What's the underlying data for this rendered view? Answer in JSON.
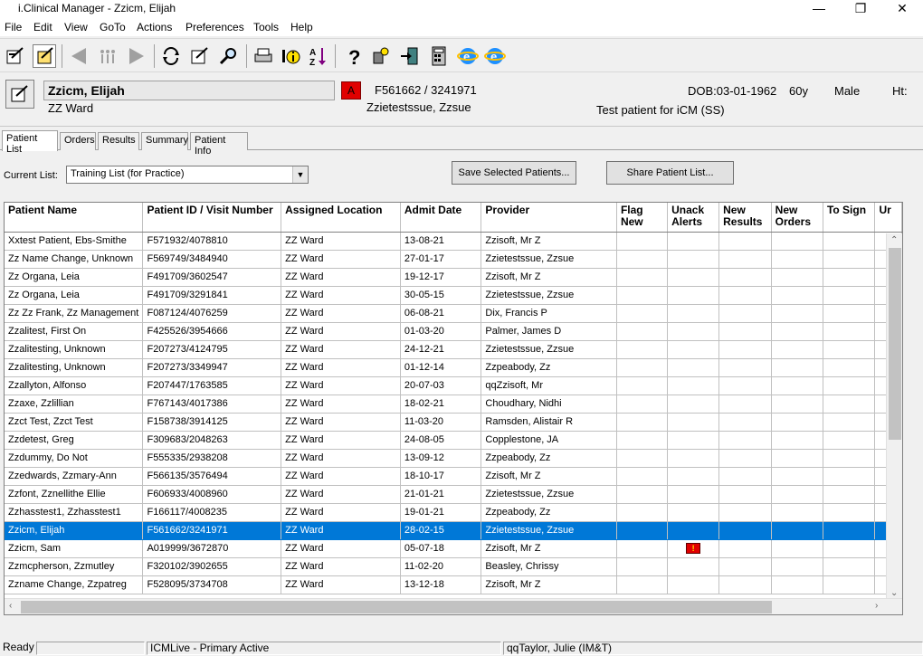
{
  "window": {
    "title": "i.Clinical Manager - Zzicm, Elijah"
  },
  "menu": [
    "File",
    "Edit",
    "View",
    "GoTo",
    "Actions",
    "Preferences",
    "Tools",
    "Help"
  ],
  "patient": {
    "name": "Zzicm, Elijah",
    "ward": "ZZ Ward",
    "alert": "A",
    "id_visit": "F561662 / 3241971",
    "provider": "Zzietestssue, Zzsue",
    "dob": "DOB:03-01-1962",
    "age": "60y",
    "sex": "Male",
    "ht": "Ht:",
    "note": "Test patient for iCM (SS)"
  },
  "tabs": [
    "Patient List",
    "Orders",
    "Results",
    "Summary",
    "Patient Info"
  ],
  "controls": {
    "current_list_label": "Current List:",
    "current_list_value": "Training List (for Practice)",
    "save_button": "Save Selected Patients...",
    "share_button": "Share Patient List..."
  },
  "table": {
    "headers": [
      "Patient Name",
      "Patient ID / Visit Number",
      "Assigned Location",
      "Admit Date",
      "Provider",
      "Flag New",
      "Unack Alerts",
      "New Results",
      "New Orders",
      "To Sign",
      "Ur"
    ],
    "header_lines": [
      [
        "Patient Name"
      ],
      [
        "Patient ID / Visit Number"
      ],
      [
        "Assigned Location"
      ],
      [
        "Admit Date"
      ],
      [
        "Provider"
      ],
      [
        "Flag",
        "New"
      ],
      [
        "Unack",
        "Alerts"
      ],
      [
        "New",
        "Results"
      ],
      [
        "New",
        "Orders"
      ],
      [
        "To Sign"
      ],
      [
        "Ur"
      ]
    ],
    "rows": [
      [
        "Xxtest Patient, Ebs-Smithe",
        "F571932/4078810",
        "ZZ Ward",
        "13-08-21",
        "Zzisoft, Mr Z"
      ],
      [
        "Zz Name Change, Unknown",
        "F569749/3484940",
        "ZZ Ward",
        "27-01-17",
        "Zzietestssue, Zzsue"
      ],
      [
        "Zz Organa, Leia",
        "F491709/3602547",
        "ZZ Ward",
        "19-12-17",
        "Zzisoft, Mr Z"
      ],
      [
        "Zz Organa, Leia",
        "F491709/3291841",
        "ZZ Ward",
        "30-05-15",
        "Zzietestssue, Zzsue"
      ],
      [
        "Zz Zz Frank, Zz Management",
        "F087124/4076259",
        "ZZ Ward",
        "06-08-21",
        "Dix, Francis P"
      ],
      [
        "Zzalitest, First On",
        "F425526/3954666",
        "ZZ Ward",
        "01-03-20",
        "Palmer, James D"
      ],
      [
        "Zzalitesting, Unknown",
        "F207273/4124795",
        "ZZ Ward",
        "24-12-21",
        "Zzietestssue, Zzsue"
      ],
      [
        "Zzalitesting, Unknown",
        "F207273/3349947",
        "ZZ Ward",
        "01-12-14",
        "Zzpeabody, Zz"
      ],
      [
        "Zzallyton, Alfonso",
        "F207447/1763585",
        "ZZ Ward",
        "20-07-03",
        "qqZzisoft, Mr"
      ],
      [
        "Zzaxe, Zzlillian",
        "F767143/4017386",
        "ZZ Ward",
        "18-02-21",
        "Choudhary, Nidhi"
      ],
      [
        "Zzct Test, Zzct Test",
        "F158738/3914125",
        "ZZ Ward",
        "11-03-20",
        "Ramsden, Alistair R"
      ],
      [
        "Zzdetest, Greg",
        "F309683/2048263",
        "ZZ Ward",
        "24-08-05",
        "Copplestone, JA"
      ],
      [
        "Zzdummy, Do Not",
        "F555335/2938208",
        "ZZ Ward",
        "13-09-12",
        "Zzpeabody, Zz"
      ],
      [
        "Zzedwards, Zzmary-Ann",
        "F566135/3576494",
        "ZZ Ward",
        "18-10-17",
        "Zzisoft, Mr Z"
      ],
      [
        "Zzfont, Zznellithe Ellie",
        "F606933/4008960",
        "ZZ Ward",
        "21-01-21",
        "Zzietestssue, Zzsue"
      ],
      [
        "Zzhasstest1, Zzhasstest1",
        "F166117/4008235",
        "ZZ Ward",
        "19-01-21",
        "Zzpeabody, Zz"
      ],
      [
        "Zzicm, Elijah",
        "F561662/3241971",
        "ZZ Ward",
        "28-02-15",
        "Zzietestssue, Zzsue"
      ],
      [
        "Zzicm, Sam",
        "A019999/3672870",
        "ZZ Ward",
        "05-07-18",
        "Zzisoft, Mr Z"
      ],
      [
        "Zzmcpherson, Zzmutley",
        "F320102/3902655",
        "ZZ Ward",
        "11-02-20",
        "Beasley, Chrissy"
      ],
      [
        "Zzname Change, Zzpatreg",
        "F528095/3734708",
        "ZZ Ward",
        "13-12-18",
        "Zzisoft, Mr Z"
      ]
    ],
    "selected_row": 16,
    "alert_row": 17
  },
  "status": {
    "ready": "Ready",
    "env": "ICMLive - Primary Active",
    "user": "qqTaylor, Julie (IM&T)"
  }
}
